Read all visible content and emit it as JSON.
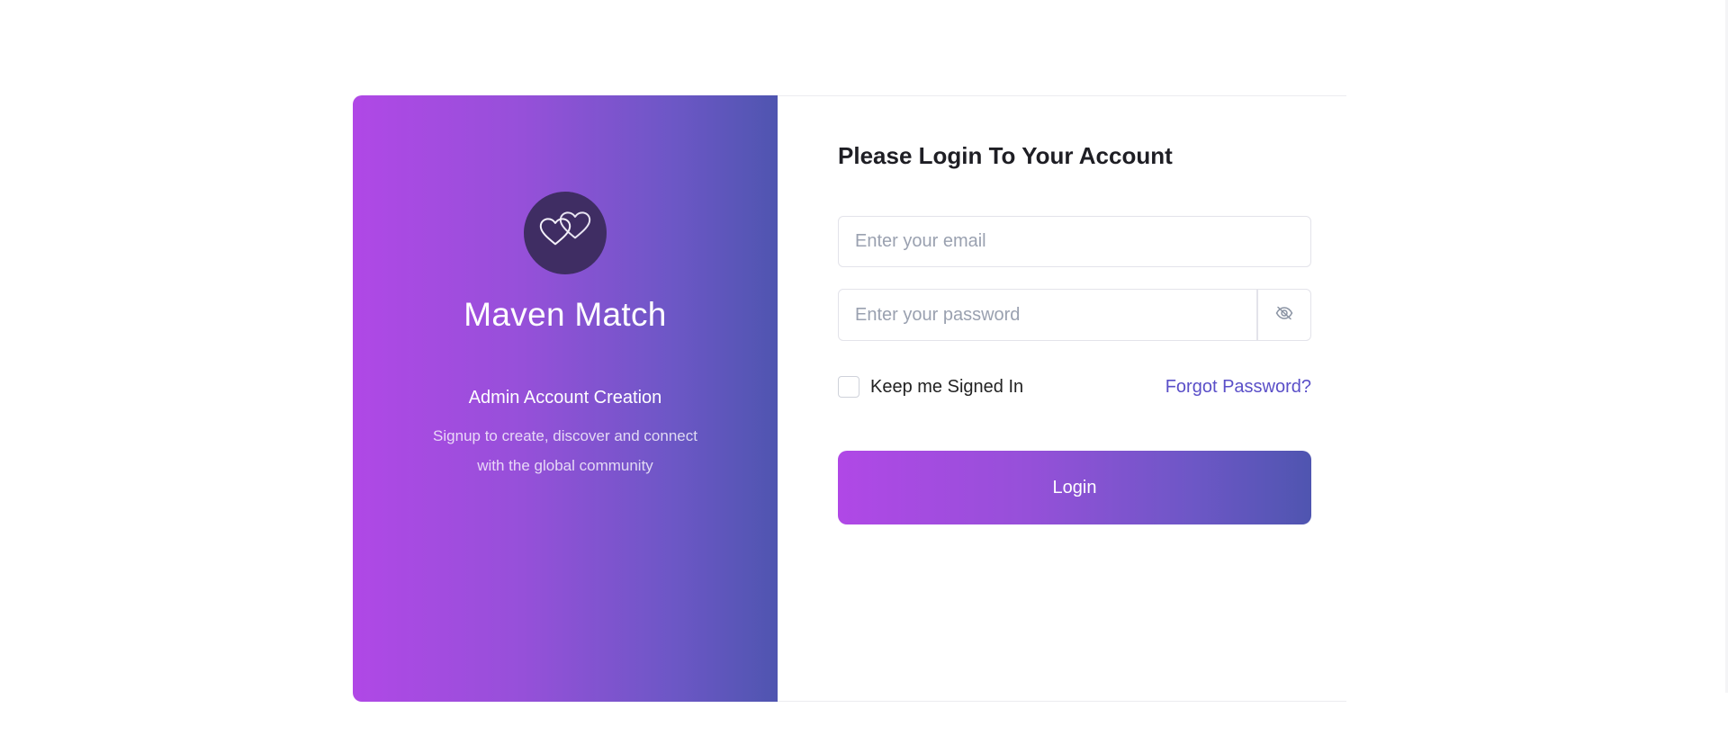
{
  "brand": {
    "logo_icon": "two-hearts-icon",
    "name": "Maven Match",
    "heading": "Admin Account Creation",
    "subtitle": "Signup to create, discover and connect with the global community",
    "gradient_start": "#b048e6",
    "gradient_end": "#4f55b0",
    "logo_bg": "#3f2d63"
  },
  "form": {
    "title": "Please Login To Your Account",
    "email_placeholder": "Enter your email",
    "email_value": "",
    "password_placeholder": "Enter your password",
    "password_value": "",
    "toggle_icon": "eye-slash-icon",
    "remember_label": "Keep me Signed In",
    "remember_checked": false,
    "forgot_label": "Forgot Password?",
    "login_label": "Login",
    "link_color": "#5a4fc8"
  }
}
